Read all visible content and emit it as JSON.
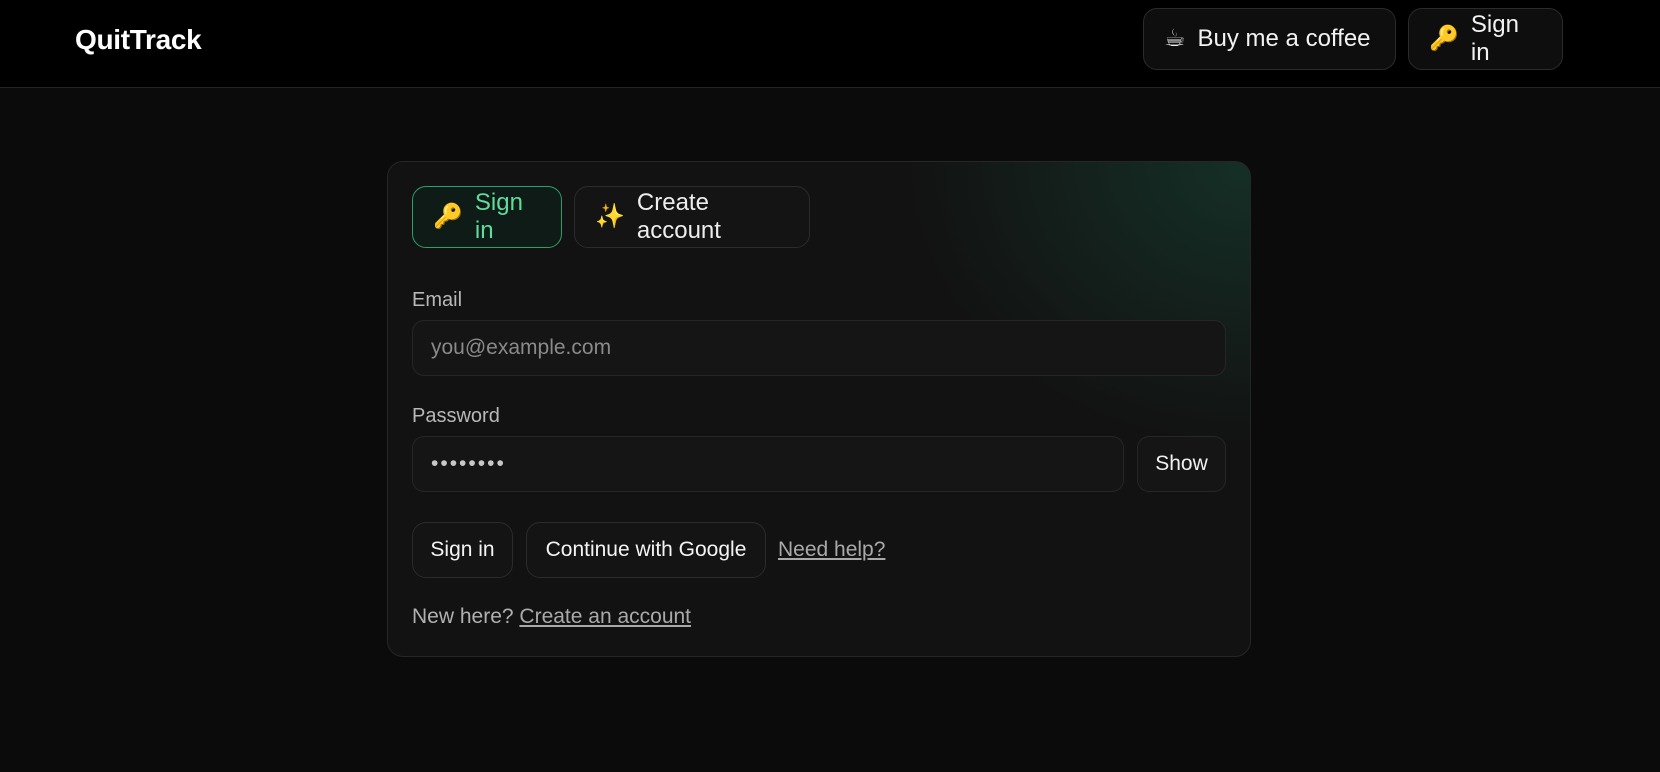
{
  "header": {
    "brand": "QuitTrack",
    "coffee_button": {
      "icon": "☕",
      "label": "Buy me a coffee"
    },
    "signin_button": {
      "icon": "🔑",
      "label": "Sign in"
    }
  },
  "auth_card": {
    "tabs": [
      {
        "icon": "🔑",
        "label": "Sign in",
        "active": true
      },
      {
        "icon": "✨",
        "label": "Create account",
        "active": false
      }
    ],
    "email": {
      "label": "Email",
      "placeholder": "you@example.com",
      "value": ""
    },
    "password": {
      "label": "Password",
      "value": "••••••••",
      "show_label": "Show"
    },
    "actions": {
      "signin_label": "Sign in",
      "google_label": "Continue with Google",
      "help_link": "Need help?"
    },
    "footer": {
      "prompt": "New here?",
      "link": "Create an account"
    }
  },
  "colors": {
    "background": "#0b0b0b",
    "accent": "#5fdc9c",
    "accent_border": "#2e9e6b"
  }
}
